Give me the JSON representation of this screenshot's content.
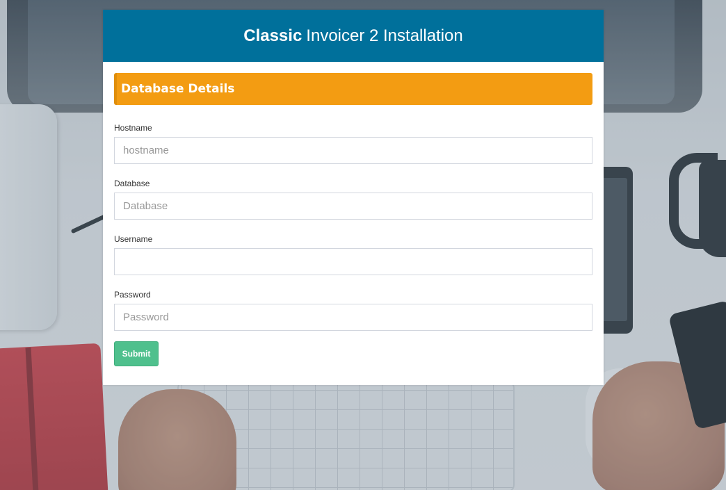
{
  "header": {
    "brand": "Classic",
    "title_rest": "Invoicer 2 Installation",
    "background_color": "#00709b"
  },
  "section": {
    "title": "Database Details",
    "color": "#f39c12"
  },
  "form": {
    "fields": [
      {
        "label": "Hostname",
        "placeholder": "hostname",
        "value": ""
      },
      {
        "label": "Database",
        "placeholder": "Database",
        "value": ""
      },
      {
        "label": "Username",
        "placeholder": "",
        "value": ""
      },
      {
        "label": "Password",
        "placeholder": "Password",
        "value": ""
      }
    ],
    "submit_label": "Submit",
    "submit_color": "#4fc08d"
  }
}
